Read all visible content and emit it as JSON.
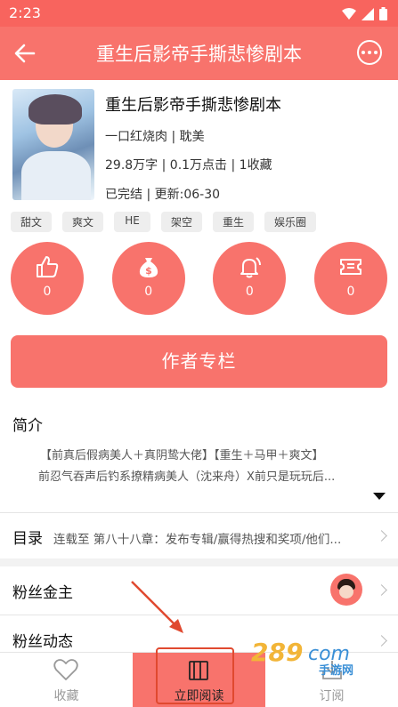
{
  "status_bar": {
    "time": "2:23"
  },
  "app_bar": {
    "title": "重生后影帝手撕悲惨剧本",
    "back_icon": "arrow-left-icon",
    "more_icon": "more-horizontal-icon"
  },
  "book": {
    "title": "重生后影帝手撕悲惨剧本",
    "author_genre": "一口红烧肉 | 耽美",
    "stats": "29.8万字 | 0.1万点击 | 1收藏",
    "status_update": "已完结 | 更新:06-30"
  },
  "tags": [
    "甜文",
    "爽文",
    "HE",
    "架空",
    "重生",
    "娱乐圈"
  ],
  "actions": [
    {
      "icon": "thumbs-up-icon",
      "count": "0"
    },
    {
      "icon": "money-bag-icon",
      "count": "0"
    },
    {
      "icon": "bell-icon",
      "count": "0"
    },
    {
      "icon": "ticket-icon",
      "count": "0"
    }
  ],
  "author_button": "作者专栏",
  "intro": {
    "heading": "简介",
    "line1": "【前真后假病美人＋真阴鸷大佬】【重生＋马甲＋爽文】",
    "line2": "前忍气吞声后钓系撩精病美人（沈来舟）X前只是玩玩后..."
  },
  "toc": {
    "label": "目录",
    "latest": "连载至 第八十八章：发布专辑/赢得热搜和奖项/他们..."
  },
  "fans_patron": {
    "label": "粉丝金主"
  },
  "fans_activity": {
    "label": "粉丝动态"
  },
  "watermark": {
    "number": "289",
    "suffix": "com",
    "text": "手游网"
  },
  "bottom_bar": {
    "collect": "收藏",
    "read_now": "立即阅读",
    "subscribe": "订阅"
  },
  "colors": {
    "primary": "#f8736c",
    "status_bar": "#f8645e",
    "highlight_border": "#e0492f"
  }
}
